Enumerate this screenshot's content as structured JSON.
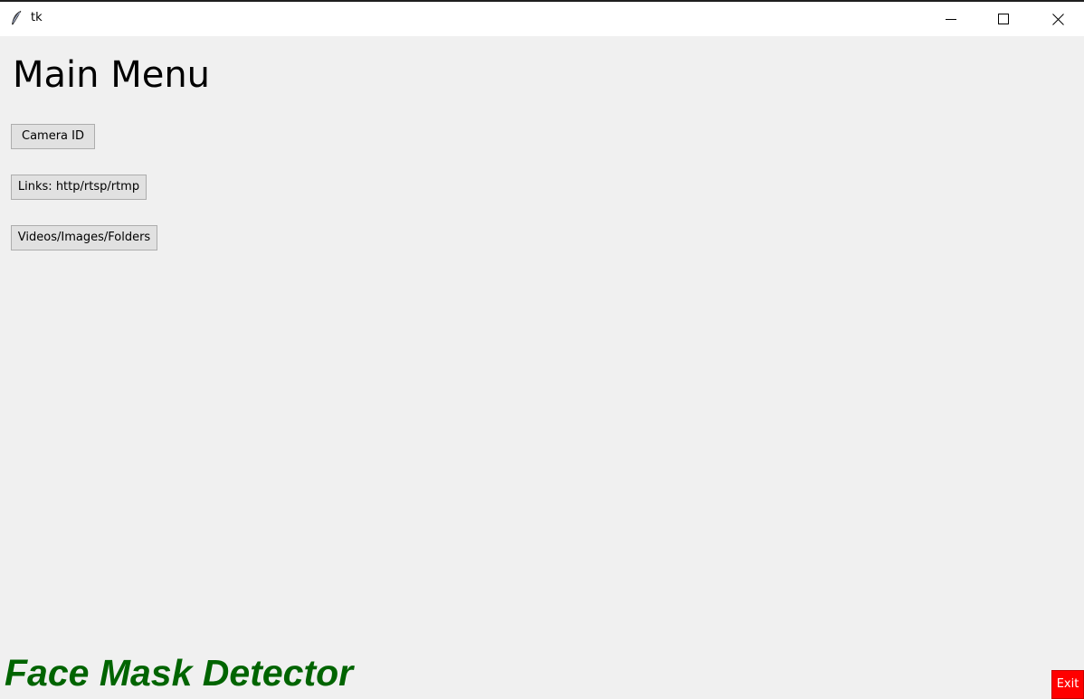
{
  "window": {
    "title": "tk",
    "icon": "feather-icon",
    "controls": {
      "minimize_icon": "minimize-icon",
      "maximize_icon": "maximize-icon",
      "close_icon": "close-icon"
    }
  },
  "main": {
    "heading": "Main Menu",
    "buttons": [
      {
        "label": "Camera ID"
      },
      {
        "label": "Links: http/rtsp/rtmp"
      },
      {
        "label": "Videos/Images/Folders"
      }
    ]
  },
  "footer": {
    "title": "Face Mask Detector",
    "title_color": "#006400",
    "exit_label": "Exit",
    "exit_background": "#ff0000",
    "exit_text_color": "#ffffff"
  },
  "colors": {
    "window_background": "#f0f0f0",
    "button_background": "#e1e1e1",
    "titlebar_background": "#ffffff"
  }
}
